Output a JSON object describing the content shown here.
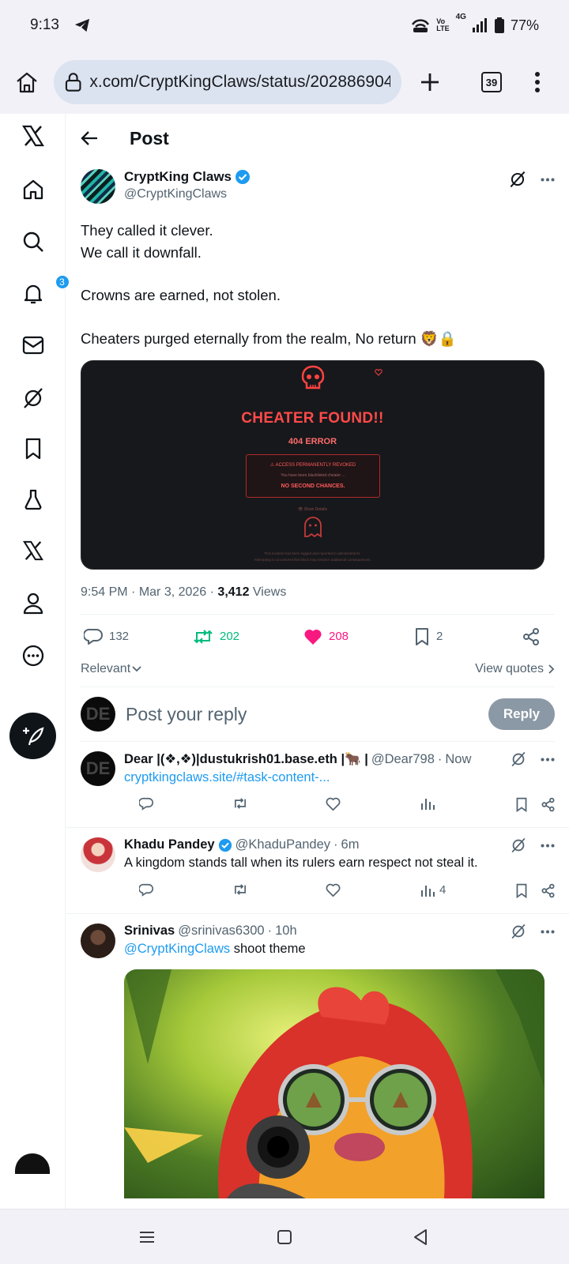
{
  "status_bar": {
    "time": "9:13",
    "network": "4G",
    "battery": "77%"
  },
  "browser": {
    "url": "x.com/CryptKingClaws/status/202886904(",
    "tab_count": "39"
  },
  "sidebar": {
    "notification_count": "3"
  },
  "header": {
    "title": "Post"
  },
  "post": {
    "author_name": "CryptKing Claws",
    "author_handle": "@CryptKingClaws",
    "lines": [
      "They called it clever.",
      "We call it downfall.",
      "",
      "Crowns are earned, not stolen.",
      "",
      "Cheaters purged eternally from the realm, No return 🦁🔒"
    ],
    "media": {
      "title": "CHEATER FOUND!!",
      "subtitle": "404 ERROR",
      "box_line1": "⚠ ACCESS PERMANENTLY REVOKED",
      "box_line2": "You have been blacklisted cheater ...",
      "box_line3": "NO SECOND CHANCES.",
      "details": "👁 Show Details",
      "footer_line1": "This incident has been logged and reported to administrators.",
      "footer_line2": "Attempting to circumvent this block may result in additional consequences."
    },
    "time": "9:54 PM",
    "date": "Mar 3, 2026",
    "views_count": "3,412",
    "views_label": "Views",
    "replies": "132",
    "reposts": "202",
    "likes": "208",
    "bookmarks": "2"
  },
  "sort": {
    "label": "Relevant",
    "view_quotes": "View quotes"
  },
  "reply_box": {
    "placeholder": "Post your reply",
    "button": "Reply",
    "avatar_text": "DE"
  },
  "replies": [
    {
      "name": "Dear |(❖,❖)|dustukrish01.base.eth |🐂 |",
      "handle": "@Dear798",
      "time": "Now",
      "link": "cryptkingclaws.site/#task-content-...",
      "views": ""
    },
    {
      "name": "Khadu Pandey",
      "handle": "@KhaduPandey",
      "time": "6m",
      "text": "A kingdom stands tall when its rulers earn respect not steal it.",
      "views": "4"
    },
    {
      "name": "Srinivas",
      "handle": "@srinivas6300",
      "time": "10h",
      "mention": "@CryptKingClaws",
      "text": "shoot theme"
    }
  ],
  "colors": {
    "accent": "#1d9bf0",
    "repost": "#00ba7c",
    "like": "#f91880"
  }
}
